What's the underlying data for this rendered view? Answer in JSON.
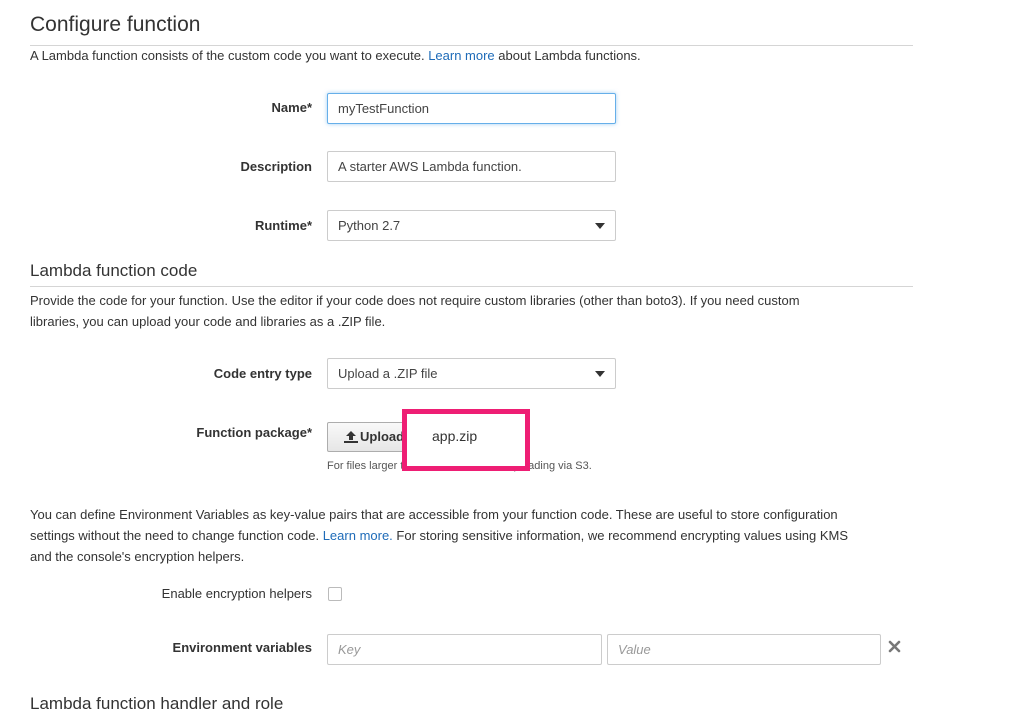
{
  "configure": {
    "title": "Configure function",
    "intro_before": "A Lambda function consists of the custom code you want to execute. ",
    "intro_link": "Learn more",
    "intro_after": " about Lambda functions."
  },
  "name_field": {
    "label": "Name*",
    "value": "myTestFunction"
  },
  "description_field": {
    "label": "Description",
    "value": "A starter AWS Lambda function."
  },
  "runtime_field": {
    "label": "Runtime*",
    "selected": "Python 2.7"
  },
  "code_section": {
    "title": "Lambda function code",
    "line1": "Provide the code for your function. Use the editor if your code does not require custom libraries (other than boto3). If you need custom",
    "line2": "libraries, you can upload your code and libraries as a .ZIP file."
  },
  "code_entry": {
    "label": "Code entry type",
    "selected": "Upload a .ZIP file"
  },
  "function_package": {
    "label": "Function package*",
    "upload_label": "Upload",
    "file_name": "app.zip",
    "hint": "For files larger than 10 MB, consider uploading via S3."
  },
  "env_intro": {
    "line1": "You can define Environment Variables as key-value pairs that are accessible from your function code. These are useful to store configuration",
    "line2_before": "settings without the need to change function code. ",
    "line2_link": "Learn more.",
    "line2_after": " For storing sensitive information, we recommend encrypting values using KMS",
    "line3": "and the console's encryption helpers."
  },
  "encryption": {
    "label": "Enable encryption helpers",
    "checked": false
  },
  "env_vars": {
    "label": "Environment variables",
    "key_placeholder": "Key",
    "value_placeholder": "Value"
  },
  "handler_section": {
    "title": "Lambda function handler and role"
  },
  "colors": {
    "link": "#1e6bb8",
    "highlight": "#ee1e74",
    "focus": "#66afe9"
  },
  "icons": {
    "upload": "upload-icon",
    "remove": "close-icon",
    "dropdown": "chevron-down-icon"
  }
}
